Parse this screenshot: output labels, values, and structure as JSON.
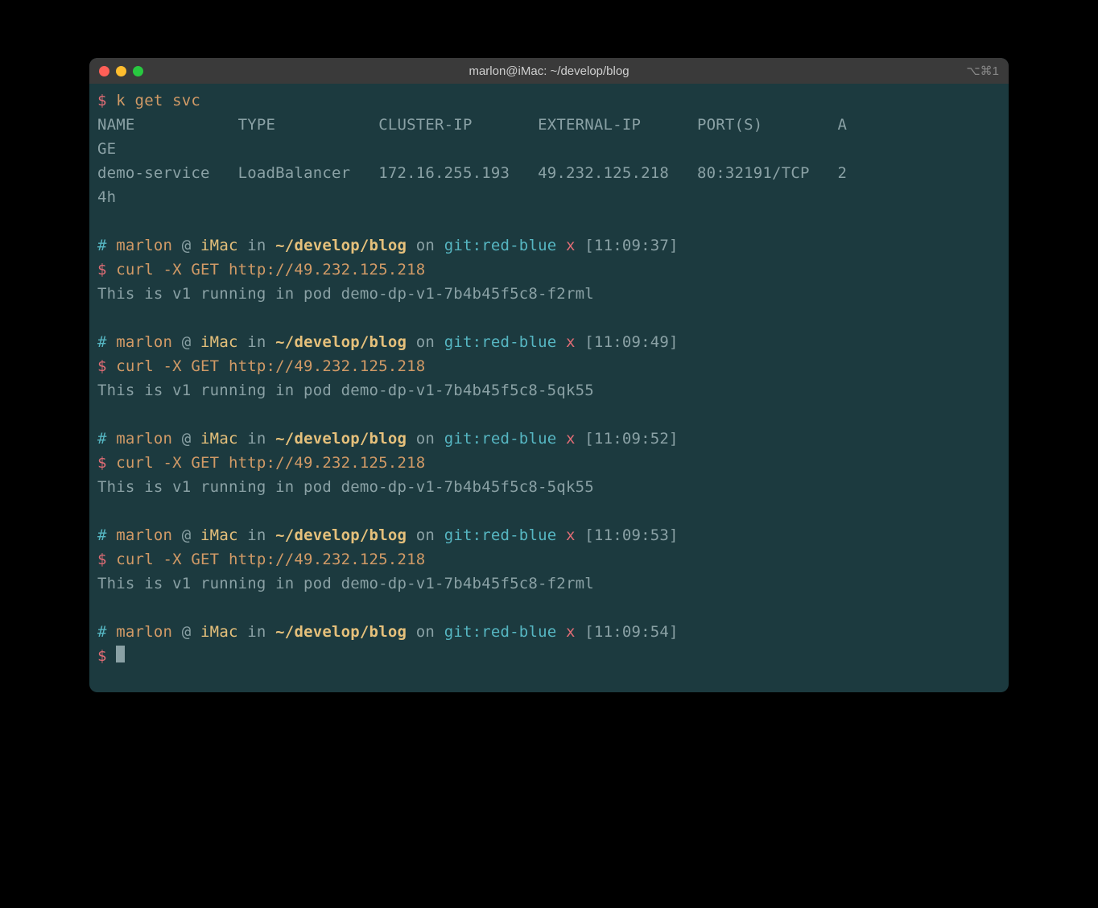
{
  "window": {
    "title": "marlon@iMac: ~/develop/blog",
    "shortcut": "⌥⌘1"
  },
  "svc_cmd": {
    "prompt": "$",
    "command": "k get svc"
  },
  "svc_table": {
    "headers": {
      "name": "NAME",
      "type": "TYPE",
      "cluster_ip": "CLUSTER-IP",
      "external_ip": "EXTERNAL-IP",
      "ports": "PORT(S)",
      "age_prefix": "A",
      "age_suffix": "GE"
    },
    "row": {
      "name": "demo-service",
      "type": "LoadBalancer",
      "cluster_ip": "172.16.255.193",
      "external_ip": "49.232.125.218",
      "ports": "80:32191/TCP",
      "age_prefix": "2",
      "age_suffix": "4h"
    }
  },
  "blocks": [
    {
      "ps": {
        "hash": "#",
        "user": "marlon",
        "at": "@",
        "host": "iMac",
        "in": "in",
        "path": "~/develop/blog",
        "on": "on",
        "git": "git:",
        "branch": "red-blue",
        "x": "x",
        "time": "[11:09:37]"
      },
      "cmd": {
        "prompt": "$",
        "text": "curl -X GET http://49.232.125.218"
      },
      "output": "This is v1 running in pod demo-dp-v1-7b4b45f5c8-f2rml"
    },
    {
      "ps": {
        "hash": "#",
        "user": "marlon",
        "at": "@",
        "host": "iMac",
        "in": "in",
        "path": "~/develop/blog",
        "on": "on",
        "git": "git:",
        "branch": "red-blue",
        "x": "x",
        "time": "[11:09:49]"
      },
      "cmd": {
        "prompt": "$",
        "text": "curl -X GET http://49.232.125.218"
      },
      "output": "This is v1 running in pod demo-dp-v1-7b4b45f5c8-5qk55"
    },
    {
      "ps": {
        "hash": "#",
        "user": "marlon",
        "at": "@",
        "host": "iMac",
        "in": "in",
        "path": "~/develop/blog",
        "on": "on",
        "git": "git:",
        "branch": "red-blue",
        "x": "x",
        "time": "[11:09:52]"
      },
      "cmd": {
        "prompt": "$",
        "text": "curl -X GET http://49.232.125.218"
      },
      "output": "This is v1 running in pod demo-dp-v1-7b4b45f5c8-5qk55"
    },
    {
      "ps": {
        "hash": "#",
        "user": "marlon",
        "at": "@",
        "host": "iMac",
        "in": "in",
        "path": "~/develop/blog",
        "on": "on",
        "git": "git:",
        "branch": "red-blue",
        "x": "x",
        "time": "[11:09:53]"
      },
      "cmd": {
        "prompt": "$",
        "text": "curl -X GET http://49.232.125.218"
      },
      "output": "This is v1 running in pod demo-dp-v1-7b4b45f5c8-f2rml"
    }
  ],
  "final_ps": {
    "hash": "#",
    "user": "marlon",
    "at": "@",
    "host": "iMac",
    "in": "in",
    "path": "~/develop/blog",
    "on": "on",
    "git": "git:",
    "branch": "red-blue",
    "x": "x",
    "time": "[11:09:54]"
  },
  "final_prompt": "$"
}
